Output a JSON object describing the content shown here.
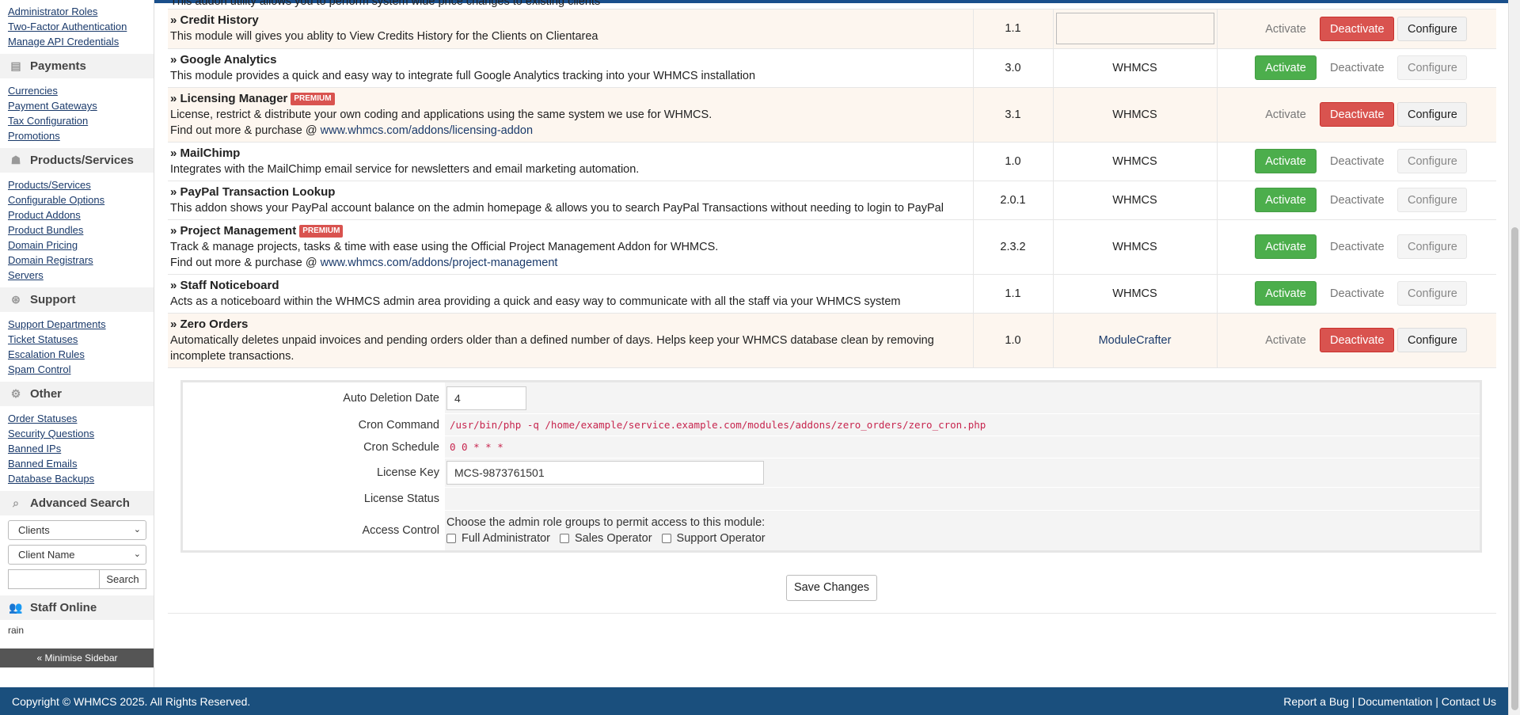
{
  "sidebar": {
    "group0": [
      "Administrator Roles",
      "Two-Factor Authentication",
      "Manage API Credentials"
    ],
    "payments": {
      "title": "Payments",
      "items": [
        "Currencies",
        "Payment Gateways",
        "Tax Configuration",
        "Promotions"
      ]
    },
    "products": {
      "title": "Products/Services",
      "items": [
        "Products/Services",
        "Configurable Options",
        "Product Addons",
        "Product Bundles",
        "Domain Pricing",
        "Domain Registrars",
        "Servers"
      ]
    },
    "support": {
      "title": "Support",
      "items": [
        "Support Departments",
        "Ticket Statuses",
        "Escalation Rules",
        "Spam Control"
      ]
    },
    "other": {
      "title": "Other",
      "items": [
        "Order Statuses",
        "Security Questions",
        "Banned IPs",
        "Banned Emails",
        "Database Backups"
      ]
    },
    "advanced_search": {
      "title": "Advanced Search",
      "select1": "Clients",
      "select2": "Client Name",
      "search_button": "Search"
    },
    "staff_online": {
      "title": "Staff Online",
      "name": "rain"
    },
    "minimise": "« Minimise Sidebar"
  },
  "top_partial": "This addon utility allows you to perform system wide price changes to existing clients",
  "modules": [
    {
      "name": "» Credit History",
      "premium": false,
      "desc": "This module will gives you ablity to View Credits History for the Clients on Clientarea",
      "link_prefix": "",
      "link": "",
      "version": "1.1",
      "author": "",
      "active": true
    },
    {
      "name": "» Google Analytics",
      "premium": false,
      "desc": "This module provides a quick and easy way to integrate full Google Analytics tracking into your WHMCS installation",
      "link_prefix": "",
      "link": "",
      "version": "3.0",
      "author": "WHMCS",
      "active": false
    },
    {
      "name": "» Licensing Manager",
      "premium": true,
      "desc": "License, restrict & distribute your own coding and applications using the same system we use for WHMCS.",
      "link_prefix": "Find out more & purchase @ ",
      "link": "www.whmcs.com/addons/licensing-addon",
      "version": "3.1",
      "author": "WHMCS",
      "active": true
    },
    {
      "name": "» MailChimp",
      "premium": false,
      "desc": "Integrates with the MailChimp email service for newsletters and email marketing automation.",
      "link_prefix": "",
      "link": "",
      "version": "1.0",
      "author": "WHMCS",
      "active": false
    },
    {
      "name": "» PayPal Transaction Lookup",
      "premium": false,
      "desc": "This addon shows your PayPal account balance on the admin homepage & allows you to search PayPal Transactions without needing to login to PayPal",
      "link_prefix": "",
      "link": "",
      "version": "2.0.1",
      "author": "WHMCS",
      "active": false
    },
    {
      "name": "» Project Management",
      "premium": true,
      "desc": "Track & manage projects, tasks & time with ease using the Official Project Management Addon for WHMCS.",
      "link_prefix": "Find out more & purchase @ ",
      "link": "www.whmcs.com/addons/project-management",
      "version": "2.3.2",
      "author": "WHMCS",
      "active": false
    },
    {
      "name": "» Staff Noticeboard",
      "premium": false,
      "desc": "Acts as a noticeboard within the WHMCS admin area providing a quick and easy way to communicate with all the staff via your WHMCS system",
      "link_prefix": "",
      "link": "",
      "version": "1.1",
      "author": "WHMCS",
      "active": false
    },
    {
      "name": "» Zero Orders",
      "premium": false,
      "desc": "Automatically deletes unpaid invoices and pending orders older than a defined number of days. Helps keep your WHMCS database clean by removing incomplete transactions.",
      "link_prefix": "",
      "link": "",
      "version": "1.0",
      "author": "ModuleCrafter",
      "active": true
    }
  ],
  "labels": {
    "premium": "PREMIUM",
    "activate": "Activate",
    "deactivate": "Deactivate",
    "configure": "Configure"
  },
  "config": {
    "auto_deletion_label": "Auto Deletion Date",
    "auto_deletion_value": "4",
    "cron_command_label": "Cron Command",
    "cron_command_value": "/usr/bin/php -q /home/example/service.example.com/modules/addons/zero_orders/zero_cron.php",
    "cron_schedule_label": "Cron Schedule",
    "cron_schedule_value": "0 0 * * *",
    "license_key_label": "License Key",
    "license_key_value": "MCS-9873761501",
    "license_status_label": "License Status",
    "license_status_value": "",
    "access_control_label": "Access Control",
    "access_control_text": "Choose the admin role groups to permit access to this module:",
    "roles": [
      "Full Administrator",
      "Sales Operator",
      "Support Operator"
    ]
  },
  "save_button": "Save Changes",
  "footer": {
    "copyright": "Copyright © WHMCS 2025. All Rights Reserved.",
    "links": [
      "Report a Bug",
      "Documentation",
      "Contact Us"
    ],
    "sep": "|"
  }
}
